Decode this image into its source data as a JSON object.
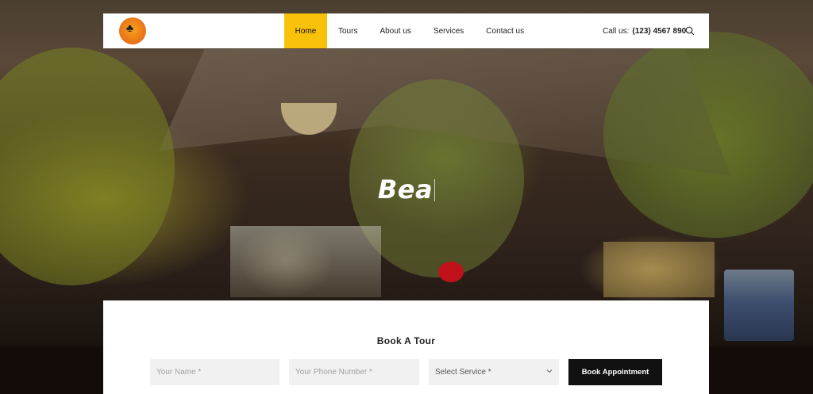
{
  "header": {
    "logo_name": "beach-logo",
    "nav": [
      {
        "label": "Home",
        "active": true
      },
      {
        "label": "Tours",
        "active": false
      },
      {
        "label": "About us",
        "active": false
      },
      {
        "label": "Services",
        "active": false
      },
      {
        "label": "Contact us",
        "active": false
      }
    ],
    "call_prefix": "Call us:",
    "call_number": "(123) 4567 890",
    "search_icon": "search-icon"
  },
  "hero": {
    "title": "Bea"
  },
  "booking": {
    "title": "Book A Tour",
    "name_placeholder": "Your Name *",
    "phone_placeholder": "Your Phone Number *",
    "service_selected": "Select Service *",
    "button_label": "Book Appointment"
  },
  "colors": {
    "accent": "#f8c20a",
    "button_bg": "#111111",
    "field_bg": "#f1f1f1"
  }
}
